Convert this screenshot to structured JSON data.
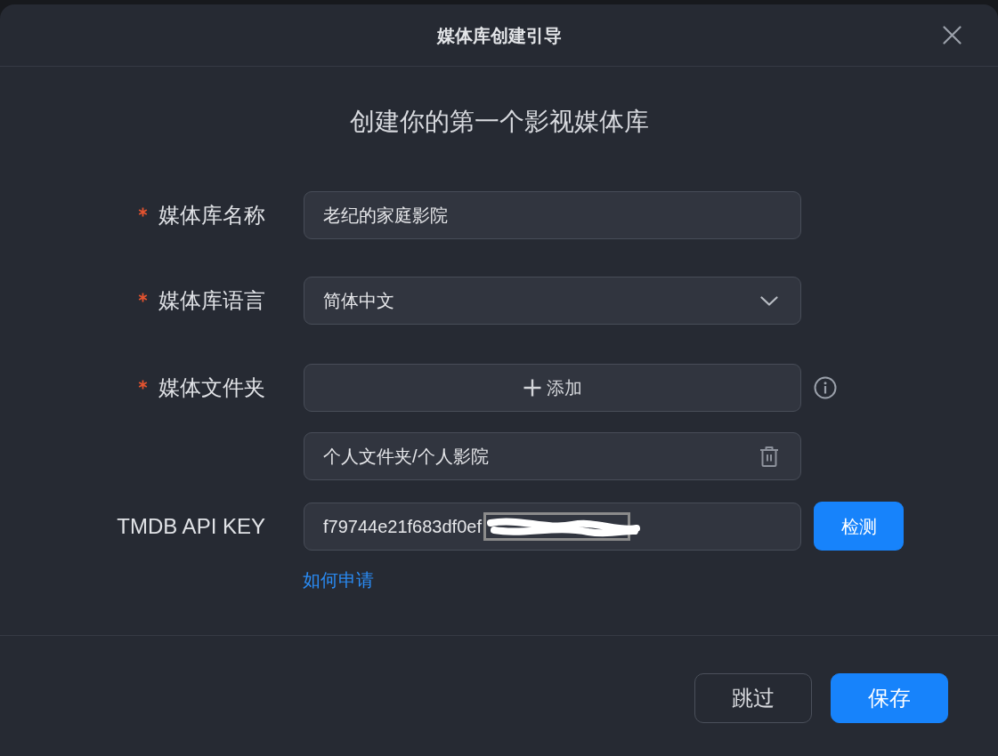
{
  "dialog": {
    "title": "媒体库创建引导"
  },
  "heading": "创建你的第一个影视媒体库",
  "form": {
    "fields": [
      {
        "kind": "text",
        "label": "媒体库名称",
        "required": true,
        "value": "老纪的家庭影院"
      },
      {
        "kind": "select",
        "label": "媒体库语言",
        "required": true,
        "value": "简体中文"
      },
      {
        "kind": "folders",
        "label": "媒体文件夹",
        "required": true,
        "add_label": "添加",
        "folders": [
          "个人文件夹/个人影院"
        ]
      },
      {
        "kind": "api_key",
        "label": "TMDB API KEY",
        "required": false,
        "value": "f79744e21f683df0ef",
        "redacted": true,
        "button": "检测",
        "link": "如何申请"
      }
    ]
  },
  "footer": {
    "buttons": [
      {
        "kind": "secondary",
        "label": "跳过"
      },
      {
        "kind": "primary",
        "label": "保存"
      }
    ]
  }
}
